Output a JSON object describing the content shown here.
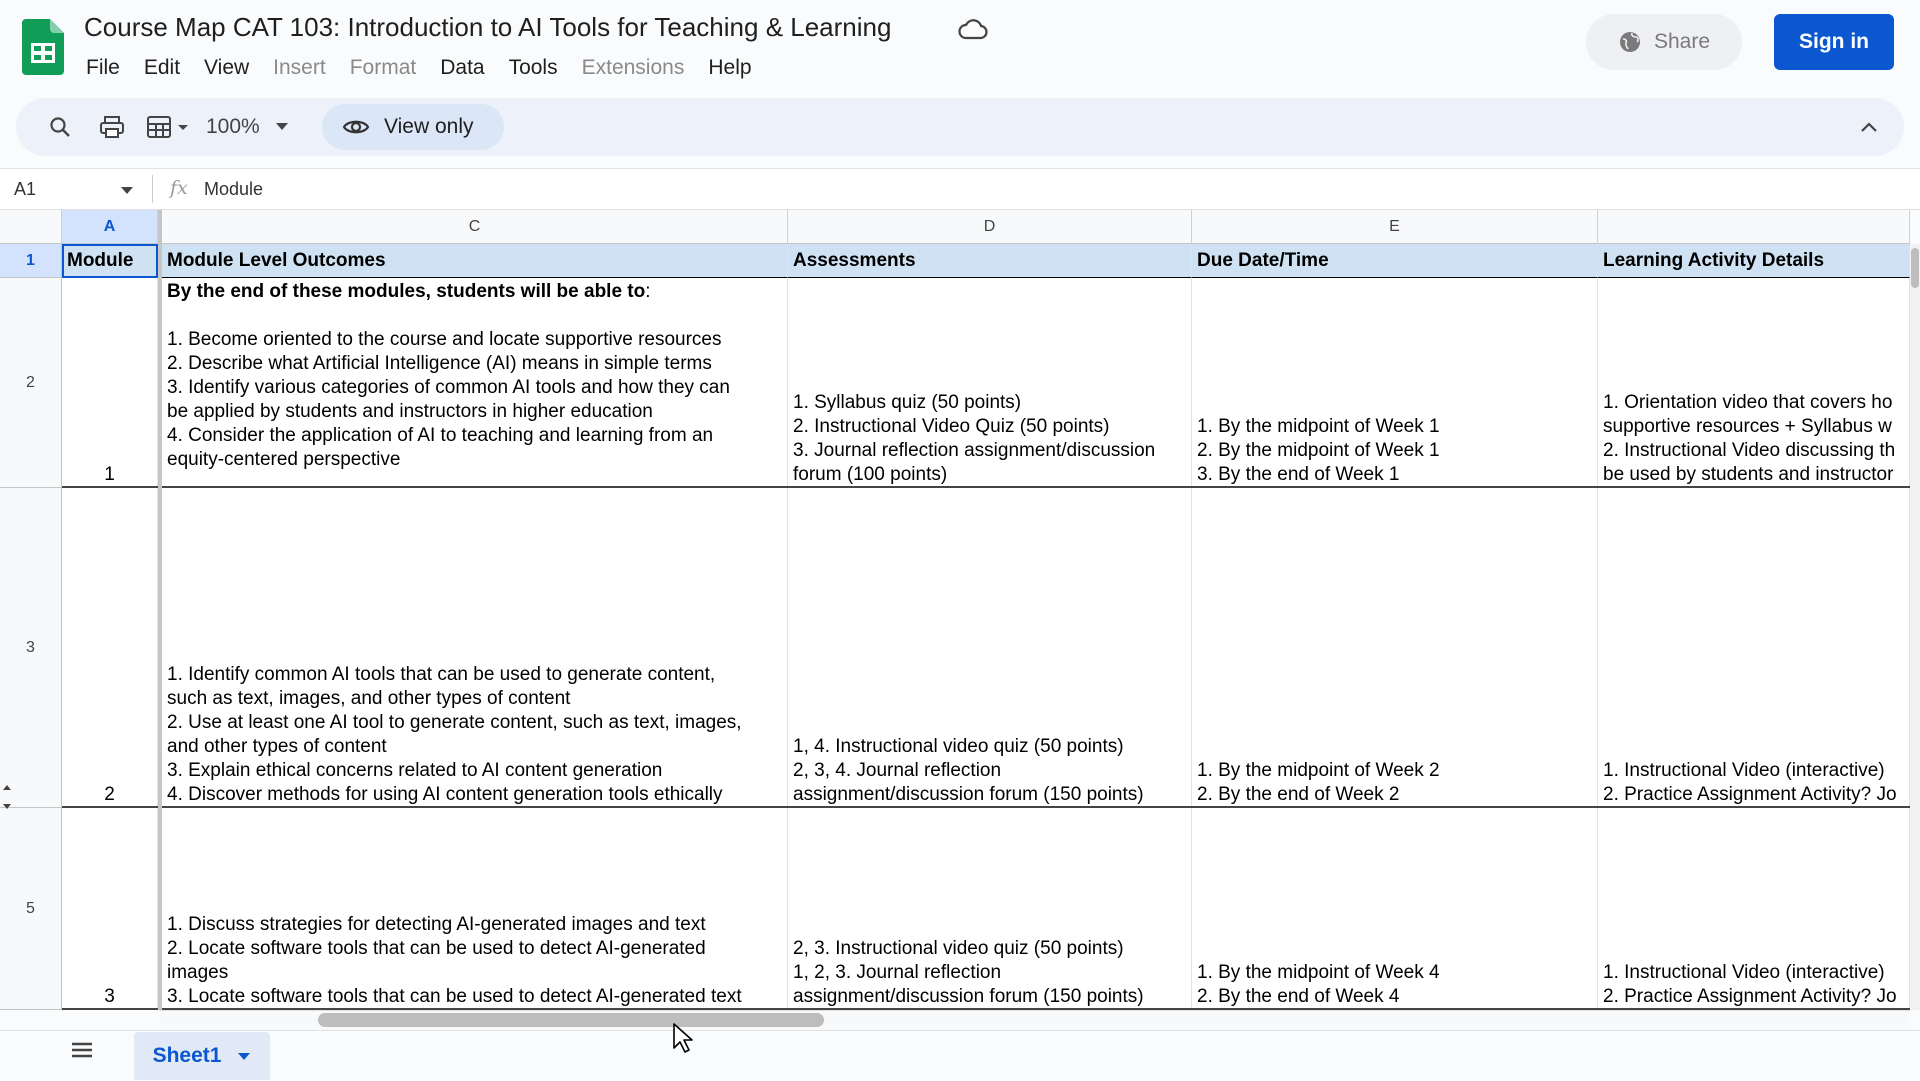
{
  "header": {
    "title": "Course Map CAT 103: Introduction to AI Tools for Teaching & Learning",
    "menu": [
      {
        "label": "File",
        "disabled": false
      },
      {
        "label": "Edit",
        "disabled": false
      },
      {
        "label": "View",
        "disabled": false
      },
      {
        "label": "Insert",
        "disabled": true
      },
      {
        "label": "Format",
        "disabled": true
      },
      {
        "label": "Data",
        "disabled": false
      },
      {
        "label": "Tools",
        "disabled": false
      },
      {
        "label": "Extensions",
        "disabled": true
      },
      {
        "label": "Help",
        "disabled": false
      }
    ],
    "share_label": "Share",
    "signin_label": "Sign in"
  },
  "toolbar": {
    "zoom": "100%",
    "view_only_label": "View only"
  },
  "formula_bar": {
    "cell_ref": "A1",
    "fx": "fx",
    "content": "Module"
  },
  "grid": {
    "columns": [
      "A",
      "C",
      "D",
      "E",
      ""
    ],
    "selected_column": "A",
    "row_numbers": [
      "1",
      "2",
      "3",
      "5"
    ],
    "selected_row": "1",
    "header_row": [
      "Module",
      "Module Level Outcomes",
      "Assessments",
      "Due Date/Time",
      "Learning Activity Details"
    ],
    "rows": [
      {
        "module": "1",
        "outcomes_lead": "By the end of these modules, students will be able to",
        "outcomes_lead_suffix": ":",
        "outcomes": "\n1. Become oriented to the course and locate supportive resources\n2. Describe what Artificial Intelligence (AI) means in simple terms\n3. Identify various categories of common AI tools and how they can\nbe applied by students and instructors in higher education\n4. Consider the application of AI to teaching and learning from an\nequity-centered perspective",
        "assessments": "1. Syllabus quiz (50 points)\n2. Instructional Video Quiz (50 points)\n3. Journal reflection assignment/discussion\nforum (100 points)",
        "due": "1. By the midpoint of Week 1\n2. By the midpoint of Week 1\n3. By the end of Week 1",
        "activities": "1. Orientation video that covers ho\nsupportive resources + Syllabus w\n2. Instructional Video discussing th\nbe used by students and instructor"
      },
      {
        "module": "2",
        "outcomes": "1. Identify common AI tools that can be used to generate content,\nsuch as text, images, and other types of content\n2. Use at least one AI tool to generate content, such as text, images,\nand other types of content\n3. Explain ethical concerns related to AI content generation\n4. Discover methods for using AI content generation tools ethically",
        "assessments": "1, 4. Instructional video quiz (50 points)\n2, 3, 4. Journal reflection\nassignment/discussion forum (150 points)",
        "due": "1. By the midpoint of Week 2\n2. By the end of Week 2",
        "activities": "1. Instructional Video (interactive)\n2. Practice Assignment Activity? Jo"
      },
      {
        "module": "3",
        "outcomes": "1. Discuss strategies for detecting AI-generated images and text\n2. Locate software tools that can be used to detect AI-generated\nimages\n3. Locate software tools that can be used to detect AI-generated text",
        "assessments": "2, 3. Instructional video quiz (50 points)\n1, 2, 3. Journal reflection\nassignment/discussion forum (150 points)",
        "due": "1. By the midpoint of Week 4\n2. By the end of Week 4",
        "activities": "1. Instructional Video (interactive)\n2. Practice Assignment Activity? Jo"
      }
    ]
  },
  "sheets": {
    "active_tab": "Sheet1"
  },
  "colors": {
    "accent": "#0b57d0",
    "header_fill": "#cfe2f3",
    "toolbar_bg": "#edf2fa"
  }
}
